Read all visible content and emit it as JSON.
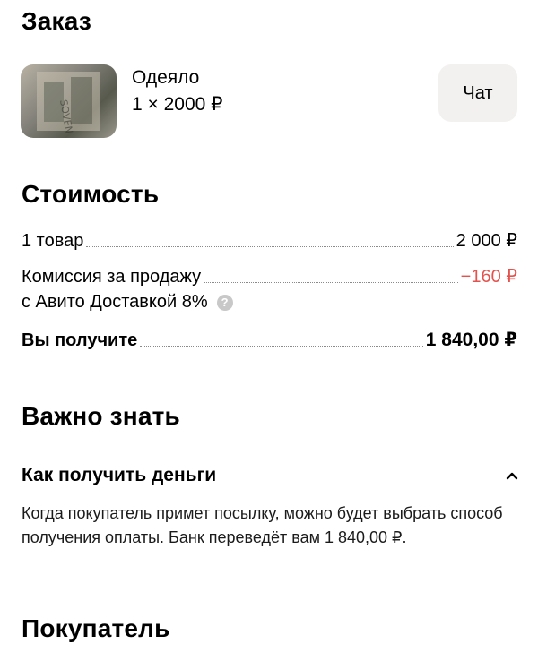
{
  "order": {
    "title": "Заказ",
    "item_name": "Одеяло",
    "item_price": "1 × 2000 ₽",
    "chat_label": "Чат"
  },
  "cost": {
    "title": "Стоимость",
    "items_label": "1 товар",
    "items_value": "2 000 ₽",
    "commission_label": "Комиссия за продажу",
    "commission_sub": "с Авито Доставкой 8%",
    "commission_value": "−160 ₽",
    "receive_label": "Вы получите",
    "receive_value": "1 840,00 ₽"
  },
  "important": {
    "title": "Важно знать",
    "accordion_title": "Как получить деньги",
    "accordion_text": "Когда покупатель примет посылку, можно будет выбрать способ получения оплаты. Банк переведёт вам 1 840,00 ₽.",
    "expanded": true
  },
  "buyer": {
    "title": "Покупатель"
  },
  "colors": {
    "negative": "#e5524d",
    "chat_bg": "#f2f1f0"
  }
}
